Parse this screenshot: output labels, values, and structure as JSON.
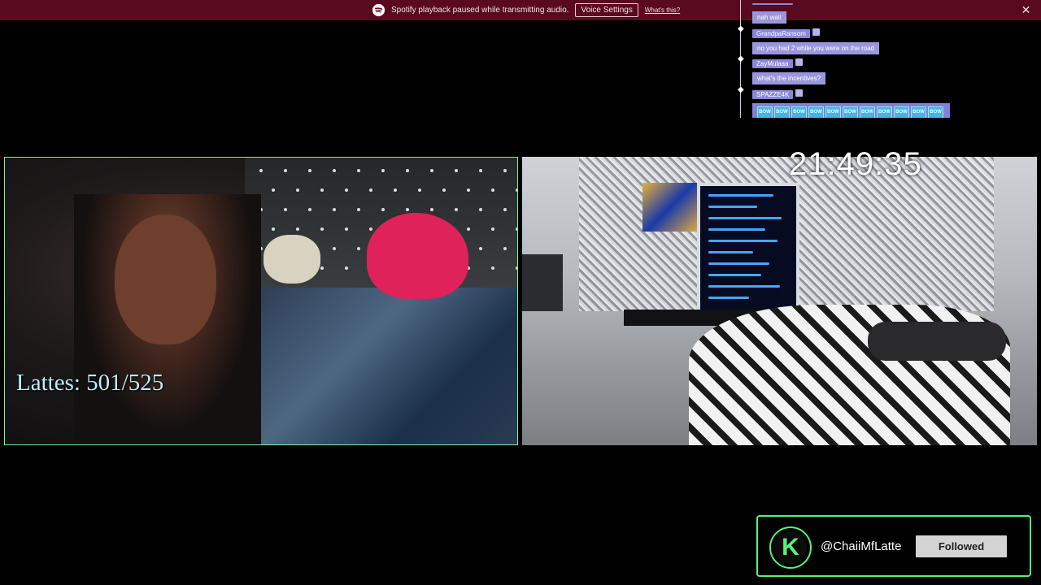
{
  "banner": {
    "icon": "spotify-icon",
    "message": "Spotify playback paused while transmitting audio.",
    "voice_settings_label": "Voice Settings",
    "whats_this_label": "What's this?",
    "close_label": "✕",
    "background": "#5a0a1e"
  },
  "chat": {
    "messages": [
      {
        "user": "",
        "text": "nah wait"
      },
      {
        "user": "GrandpaRansom",
        "text": "no you had 2 while you were on the road"
      },
      {
        "user": "ZayMulaaa",
        "text": "what's the incentives?"
      },
      {
        "user": "SPAZZE4K",
        "emote_label": "BOW",
        "emote_count": 11
      }
    ]
  },
  "overlay": {
    "lattes_text": "Lattes: 501/525",
    "clock": "21:49:35"
  },
  "follow_card": {
    "logo_letter": "K",
    "handle": "@ChaiiMfLatte",
    "button_label": "Followed",
    "accent": "#53f37a"
  }
}
